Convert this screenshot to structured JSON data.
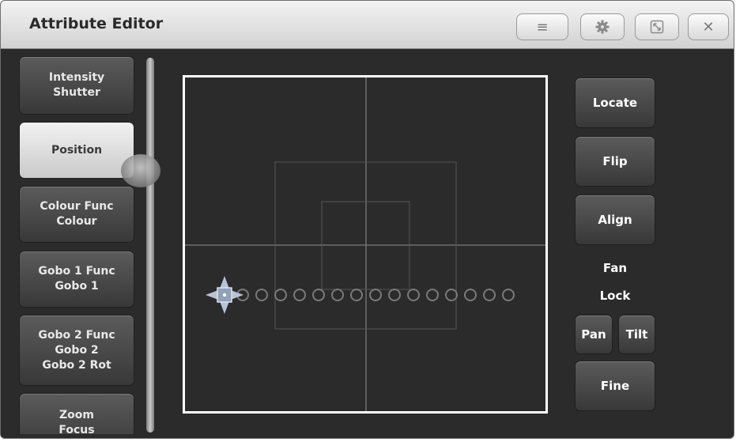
{
  "window": {
    "title": "Attribute Editor",
    "menu_icon": "≡",
    "settings_icon": "gear",
    "resize_icon": "resize",
    "close_icon": "✕"
  },
  "attribute_groups": [
    {
      "lines": [
        "Intensity",
        "Shutter"
      ],
      "selected": false
    },
    {
      "lines": [
        "Position"
      ],
      "selected": true
    },
    {
      "lines": [
        "Colour Func",
        "Colour"
      ],
      "selected": false
    },
    {
      "lines": [
        "Gobo 1 Func",
        "Gobo 1"
      ],
      "selected": false
    },
    {
      "lines": [
        "Gobo 2 Func",
        "Gobo 2",
        "Gobo 2 Rot"
      ],
      "selected": false
    },
    {
      "lines": [
        "Zoom",
        "Focus"
      ],
      "selected": false
    }
  ],
  "position_grid": {
    "fixture_marker_count": 15
  },
  "controls": {
    "locate": "Locate",
    "flip": "Flip",
    "align": "Align",
    "fan": "Fan",
    "lock": "Lock",
    "pan": "Pan",
    "tilt": "Tilt",
    "fine": "Fine"
  },
  "colors": {
    "background": "#2b2b2b",
    "grid_border": "#ffffff",
    "grid_lines": "#707070",
    "selected_button": "#d9d9d9"
  }
}
